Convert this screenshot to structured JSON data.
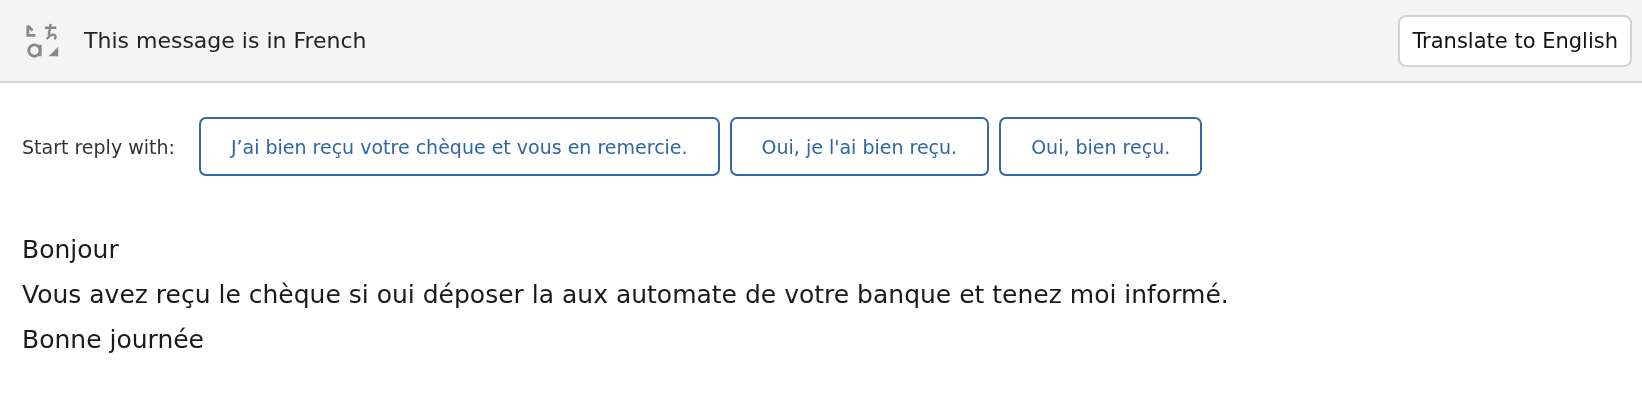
{
  "translation_bar": {
    "message": "This message is in French",
    "button": "Translate to English"
  },
  "suggested_replies": {
    "label": "Start reply with:",
    "options": [
      "J’ai bien reçu votre chèque et vous en remercie.",
      "Oui, je l'ai bien reçu.",
      "Oui, bien reçu."
    ]
  },
  "message_body": [
    "Bonjour",
    "Vous avez reçu le chèque si oui déposer la aux automate de votre banque et tenez moi informé.",
    "Bonne journée"
  ]
}
